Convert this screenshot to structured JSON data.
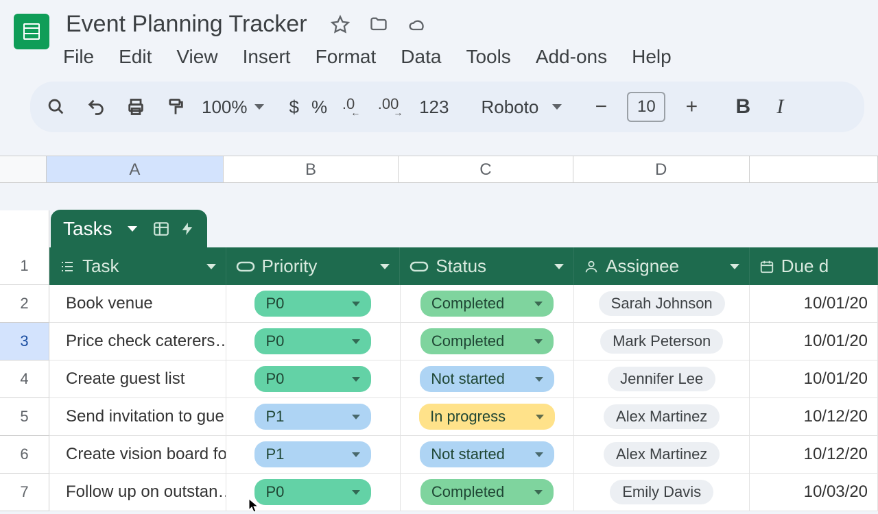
{
  "doc": {
    "title": "Event Planning Tracker"
  },
  "menu": {
    "file": "File",
    "edit": "Edit",
    "view": "View",
    "insert": "Insert",
    "format": "Format",
    "data": "Data",
    "tools": "Tools",
    "addons": "Add-ons",
    "help": "Help"
  },
  "toolbar": {
    "zoom": "100%",
    "currency": "$",
    "percent": "%",
    "dec_dec": ".0",
    "dec_inc": ".00",
    "num_format": "123",
    "font": "Roboto",
    "font_size": "10",
    "bold": "B",
    "italic": "I"
  },
  "columns": {
    "A": "A",
    "B": "B",
    "C": "C",
    "D": "D"
  },
  "table": {
    "name": "Tasks",
    "headers": {
      "task": "Task",
      "priority": "Priority",
      "status": "Status",
      "assignee": "Assignee",
      "due": "Due d"
    }
  },
  "row_numbers": [
    "1",
    "2",
    "3",
    "4",
    "5",
    "6",
    "7"
  ],
  "rows": [
    {
      "task": "Book venue",
      "priority": "P0",
      "priority_class": "p0",
      "status": "Completed",
      "status_class": "completed",
      "assignee": "Sarah Johnson",
      "due": "10/01/20"
    },
    {
      "task": "Price check caterers…",
      "priority": "P0",
      "priority_class": "p0",
      "status": "Completed",
      "status_class": "completed",
      "assignee": "Mark Peterson",
      "due": "10/01/20"
    },
    {
      "task": "Create guest list",
      "priority": "P0",
      "priority_class": "p0",
      "status": "Not started",
      "status_class": "notstarted",
      "assignee": "Jennifer Lee",
      "due": "10/01/20"
    },
    {
      "task": "Send invitation to gue…",
      "priority": "P1",
      "priority_class": "p1",
      "status": "In progress",
      "status_class": "inprogress",
      "assignee": "Alex Martinez",
      "due": "10/12/20"
    },
    {
      "task": "Create vision board fo…",
      "priority": "P1",
      "priority_class": "p1",
      "status": "Not started",
      "status_class": "notstarted",
      "assignee": "Alex Martinez",
      "due": "10/12/20"
    },
    {
      "task": "Follow up on outstan…",
      "priority": "P0",
      "priority_class": "p0",
      "status": "Completed",
      "status_class": "completed",
      "assignee": "Emily Davis",
      "due": "10/03/20"
    }
  ]
}
